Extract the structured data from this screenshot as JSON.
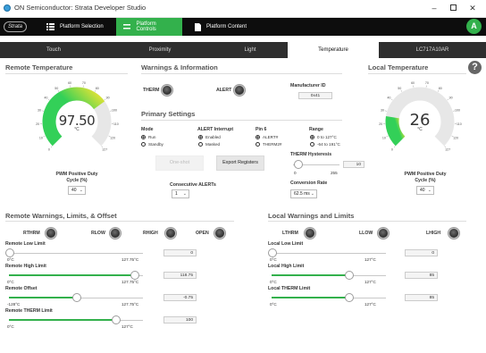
{
  "window": {
    "title": "ON Semiconductor: Strata Developer Studio"
  },
  "app": {
    "logo": "Strata",
    "nav": [
      {
        "label": "Platform Selection"
      },
      {
        "label": "Platform Controls"
      },
      {
        "label": "Platform Content"
      }
    ],
    "avatar": "A"
  },
  "tabs": [
    {
      "label": "Touch"
    },
    {
      "label": "Proximity"
    },
    {
      "label": "Light"
    },
    {
      "label": "Temperature"
    },
    {
      "label": "LC717A10AR"
    }
  ],
  "remote_temp": {
    "title": "Remote Temperature",
    "value": "97.50",
    "unit": "°C",
    "fraction": 0.7,
    "scale": [
      "0",
      "10",
      "20",
      "30",
      "40",
      "50",
      "60",
      "70",
      "80",
      "90",
      "100",
      "110",
      "120",
      "127"
    ],
    "pwm_label": "PWM Positive Duty Cycle (%)",
    "pwm_value": "40"
  },
  "local_temp": {
    "title": "Local Temperature",
    "value": "26",
    "unit": "°C",
    "fraction": 0.2,
    "scale": [
      "0",
      "10",
      "20",
      "30",
      "40",
      "50",
      "60",
      "70",
      "80",
      "90",
      "100",
      "110",
      "120",
      "127"
    ],
    "pwm_label": "PWM Positive Duty Cycle (%)",
    "pwm_value": "40"
  },
  "warnings": {
    "title": "Warnings & Information",
    "therm": "THERM",
    "alert": "ALERT",
    "mfr_label": "Manufacturer ID",
    "mfr_value": "0x41"
  },
  "primary": {
    "title": "Primary Settings",
    "mode": {
      "label": "Mode",
      "options": [
        "Run",
        "Standby"
      ]
    },
    "alert_interrupt": {
      "label": "ALERT Interrupt",
      "options": [
        "Enabled",
        "Masked"
      ]
    },
    "pin6": {
      "label": "Pin 6",
      "options": [
        "ALERT#",
        "THERM2#"
      ]
    },
    "range": {
      "label": "Range",
      "options": [
        "0 to 127°C",
        "-64 to 191°C"
      ]
    },
    "oneshot": "One-shot",
    "export": "Export Registers",
    "hyst": {
      "label": "THERM Hysteresis",
      "value": "10",
      "min": "0",
      "max": "255",
      "fraction": 0.04
    },
    "consec": {
      "label": "Consecutive ALERTs",
      "value": "1"
    },
    "conv": {
      "label": "Conversion Rate",
      "value": "62.5 ms"
    }
  },
  "remote_limits": {
    "title": "Remote Warnings, Limits, & Offset",
    "leds": [
      "RTHRM",
      "RLOW",
      "RHIGH",
      "OPEN"
    ],
    "sliders": [
      {
        "label": "Remote Low Limit",
        "value": "0",
        "min": "0°C",
        "max": "127.75°C",
        "fraction": 0
      },
      {
        "label": "Remote High Limit",
        "value": "118.75",
        "min": "0°C",
        "max": "127.75°C",
        "fraction": 0.93
      },
      {
        "label": "Remote Offset",
        "value": "-0.75",
        "min": "-128°C",
        "max": "127.75°C",
        "fraction": 0.5
      },
      {
        "label": "Remote THERM Limit",
        "value": "100",
        "min": "0°C",
        "max": "127°C",
        "fraction": 0.79
      }
    ]
  },
  "local_limits": {
    "title": "Local Warnings and Limits",
    "leds": [
      "LTHRM",
      "LLOW",
      "LHIGH"
    ],
    "sliders": [
      {
        "label": "Local Low Limit",
        "value": "0",
        "min": "0°C",
        "max": "127°C",
        "fraction": 0
      },
      {
        "label": "Local High Limit",
        "value": "85",
        "min": "0°C",
        "max": "127°C",
        "fraction": 0.67
      },
      {
        "label": "Local THERM Limit",
        "value": "85",
        "min": "0°C",
        "max": "127°C",
        "fraction": 0.67
      }
    ]
  },
  "colors": {
    "accent": "#33b14c",
    "gauge_green": "#33d058",
    "gauge_yellow": "#e0e336",
    "dark": "#0d0d0d"
  }
}
